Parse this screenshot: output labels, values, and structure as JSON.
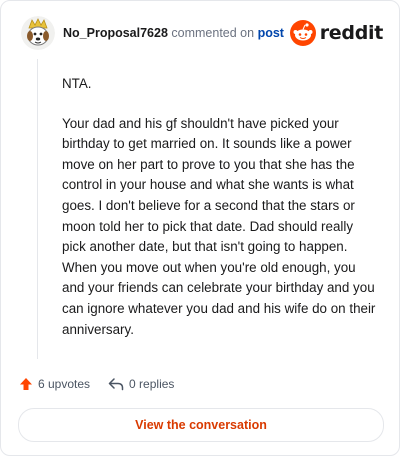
{
  "header": {
    "username": "No_Proposal7628",
    "action_text": "commented on",
    "target_link": "post"
  },
  "brand": {
    "wordmark": "reddit",
    "accent": "#ff4500"
  },
  "comment": {
    "paragraphs": [
      "NTA.",
      "Your dad and his gf shouldn't have picked your birthday to get married on. It sounds like a power move on her part to prove to you that she has the control in your house and what she wants is what goes. I don't believe for a second that the stars or moon told her to pick that date. Dad should really pick another date, but that isn't going to happen. When you move out when you're old enough, you and your friends can celebrate your birthday and you can ignore whatever you dad and his wife do on their anniversary."
    ]
  },
  "actions": {
    "upvotes_label": "6 upvotes",
    "replies_label": "0 replies",
    "upvote_icon": "upvote-arrow-icon",
    "reply_icon": "reply-arrow-icon"
  },
  "cta": {
    "label": "View the conversation",
    "color": "#d93a00"
  }
}
